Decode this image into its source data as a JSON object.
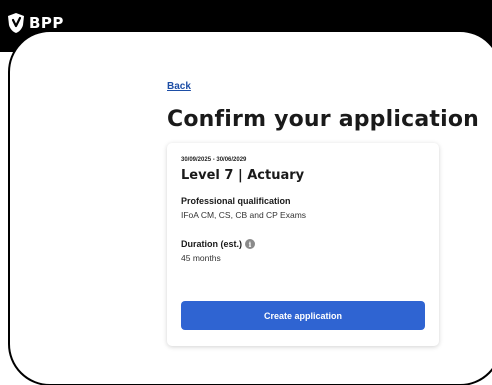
{
  "header": {
    "brand": "BPP"
  },
  "page": {
    "back_label": "Back",
    "title": "Confirm your application"
  },
  "card": {
    "dates": "30/09/2025 - 30/06/2029",
    "course_title": "Level 7 | Actuary",
    "qualification_label": "Professional qualification",
    "qualification_value": "IFoA CM, CS, CB and CP Exams",
    "duration_label": "Duration (est.)",
    "duration_value": "45 months",
    "info_icon_glyph": "i",
    "cta_label": "Create application"
  },
  "colors": {
    "topbar": "#000000",
    "link": "#1d4ea6",
    "cta": "#2f64d2"
  }
}
